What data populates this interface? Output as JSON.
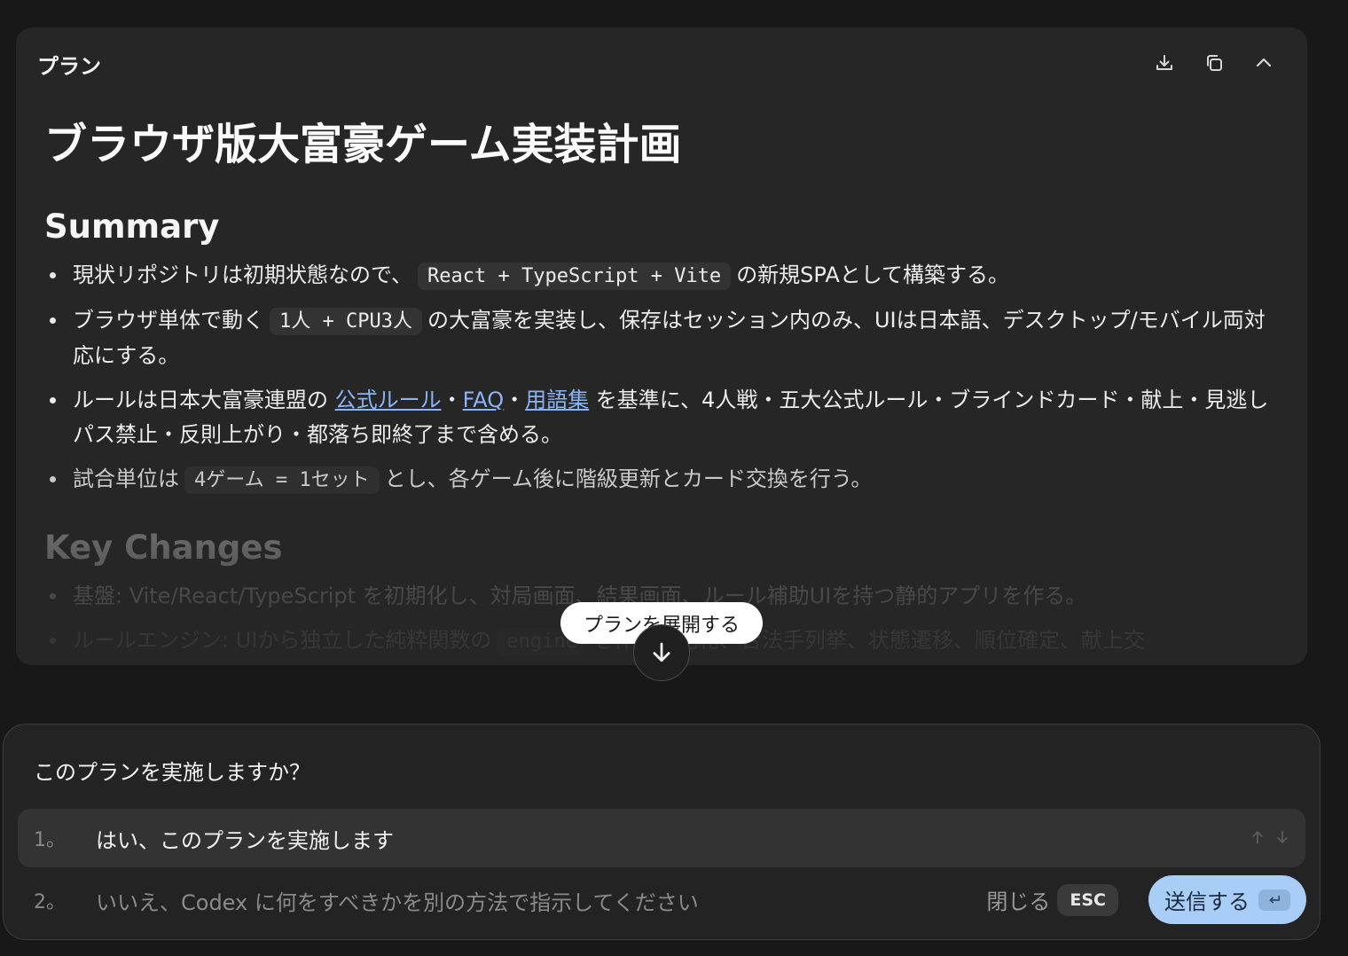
{
  "plan": {
    "label": "プラン",
    "title": "ブラウザ版大富豪ゲーム実装計画",
    "summary_heading": "Summary",
    "summary": {
      "b1_pre": "現状リポジトリは初期状態なので、",
      "b1_code": "React + TypeScript + Vite",
      "b1_post": "の新規SPAとして構築する。",
      "b2_pre": "ブラウザ単体で動く",
      "b2_code": "1人 + CPU3人",
      "b2_post": "の大富豪を実装し、保存はセッション内のみ、UIは日本語、デスクトップ/モバイル両対応にする。",
      "b3_pre": "ルールは日本大富豪連盟の",
      "b3_link1": "公式ルール",
      "b3_sep1": "・",
      "b3_link2": "FAQ",
      "b3_sep2": "・",
      "b3_link3": "用語集",
      "b3_post": "を基準に、4人戦・五大公式ルール・ブラインドカード・献上・見逃しパス禁止・反則上がり・都落ち即終了まで含める。",
      "b4_pre": "試合単位は",
      "b4_code": "4ゲーム = 1セット",
      "b4_post": "とし、各ゲーム後に階級更新とカード交換を行う。"
    },
    "key_changes_heading": "Key Changes",
    "key_changes": {
      "k1": "基盤: Vite/React/TypeScript を初期化し、対局画面、結果画面、ルール補助UIを持つ静的アプリを作る。",
      "k2_pre": "ルールエンジン: UIから独立した純粋関数の",
      "k2_code": "engine",
      "k2_post": "を作り、配札、合法手列挙、状態遷移、順位確定、献上交"
    },
    "expand_label": "プランを展開する"
  },
  "prompt": {
    "question": "このプランを実施しますか？",
    "options": [
      {
        "num": "1。",
        "text": "はい、このプランを実施します"
      },
      {
        "num": "2。",
        "text": "いいえ、Codex に何をすべきかを別の方法で指示してください"
      }
    ],
    "close_label": "閉じる",
    "close_key": "ESC",
    "submit_label": "送信する"
  },
  "icons": {
    "download": "download-icon",
    "copy": "copy-icon",
    "collapse": "chevron-up-icon",
    "scroll": "arrow-down-icon",
    "enter": "enter-key-icon"
  },
  "colors": {
    "accent": "#a8cdf7",
    "link": "#8ab4f8"
  }
}
